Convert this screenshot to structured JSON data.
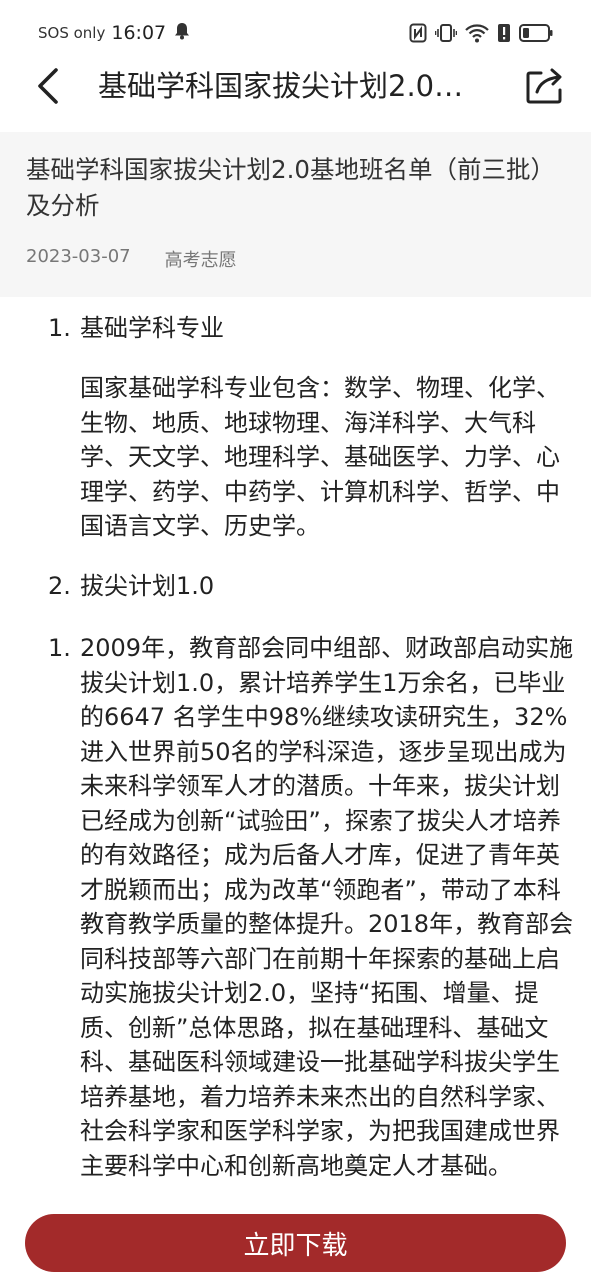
{
  "status_bar": {
    "sos": "SOS only",
    "time": "16:07"
  },
  "nav": {
    "title": "基础学科国家拔尖计划2.0…"
  },
  "article": {
    "title": "基础学科国家拔尖计划2.0基地班名单（前三批）及分析",
    "date": "2023-03-07",
    "category": "高考志愿"
  },
  "body": {
    "section1": {
      "num": "1.",
      "heading": "基础学科专业",
      "paragraph": "国家基础学科专业包含：数学、物理、化学、生物、地质、地球物理、海洋科学、大气科学、天文学、地理科学、基础医学、力学、心理学、药学、中药学、计算机科学、哲学、中国语言文学、历史学。"
    },
    "section2": {
      "num": "2.",
      "heading": "拔尖计划1.0"
    },
    "section3": {
      "num": "1.",
      "paragraph": "2009年，教育部会同中组部、财政部启动实施拔尖计划1.0，累计培养学生1万余名，已毕业的6647 名学生中98%继续攻读研究生，32%进入世界前50名的学科深造，逐步呈现出成为未来科学领军人才的潜质。十年来，拔尖计划已经成为创新“试验田”，探索了拔尖人才培养的有效路径；成为后备人才库，促进了青年英才脱颖而出；成为改革“领跑者”，带动了本科教育教学质量的整体提升。2018年，教育部会同科技部等六部门在前期十年探索的基础上启动实施拔尖计划2.0，坚持“拓围、增量、提质、创新”总体思路，拟在基础理科、基础文科、基础医科领域建设一批基础学科拔尖学生培养基地，着力培养未来杰出的自然科学家、社会科学家和医学科学家，为把我国建成世界主要科学中心和创新高地奠定人才基础。"
    }
  },
  "download_button": {
    "label": "立即下载"
  },
  "icons": {
    "back": "back-arrow-icon",
    "share": "share-icon",
    "notification": "bell-icon",
    "nfc": "nfc-icon",
    "vibrate": "vibrate-icon",
    "wifi": "wifi-icon",
    "alert": "alert-icon",
    "battery": "battery-icon"
  },
  "colors": {
    "accent": "#a32a2a",
    "header_bg": "#f6f6f6"
  }
}
